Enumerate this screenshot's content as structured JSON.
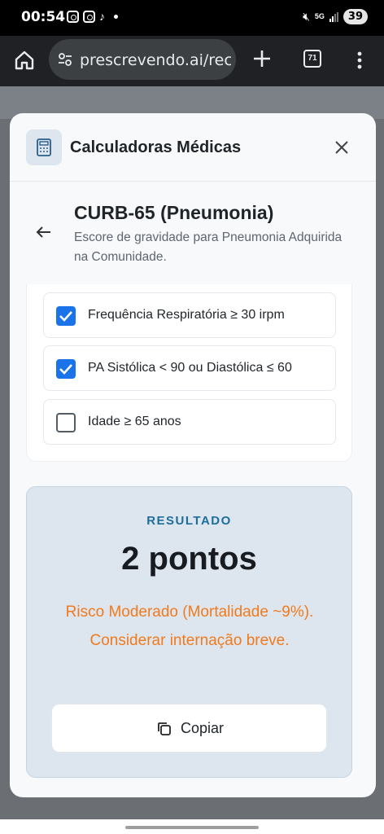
{
  "status_bar": {
    "time": "00:54",
    "network": "5G",
    "battery": "39"
  },
  "browser": {
    "url": "prescrevendo.ai/reco",
    "tab_count": "71"
  },
  "modal": {
    "title": "Calculadoras Médicas",
    "icon": "calculator-icon"
  },
  "calculator": {
    "title": "CURB-65 (Pneumonia)",
    "description": "Escore de gravidade para Pneumonia Adquirida na Comunidade."
  },
  "criteria": [
    {
      "label": "Frequência Respiratória ≥ 30 irpm",
      "checked": true
    },
    {
      "label": "PA Sistólica < 90 ou Diastólica ≤ 60",
      "checked": true
    },
    {
      "label": "Idade ≥ 65 anos",
      "checked": false
    }
  ],
  "result": {
    "label": "RESULTADO",
    "value": "2 pontos",
    "interpretation": "Risco Moderado (Mortalidade ~9%). Considerar internação breve.",
    "copy_label": "Copiar"
  },
  "colors": {
    "accent": "#1a73e8",
    "result_label": "#1d6d9c",
    "risk_text": "#f07a1d",
    "result_bg": "#dde6ee"
  }
}
